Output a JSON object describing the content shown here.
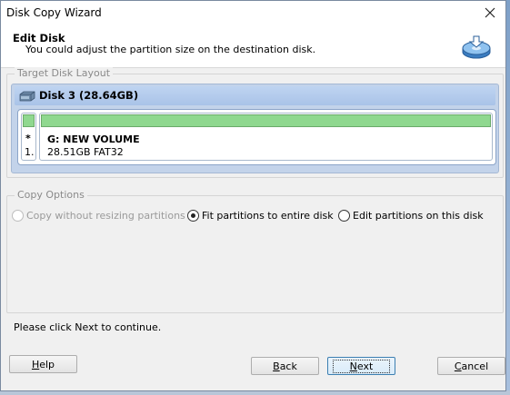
{
  "window": {
    "title": "Disk Copy Wizard"
  },
  "header": {
    "title": "Edit Disk",
    "subtitle": "You could adjust the partition size on the destination disk."
  },
  "target_layout": {
    "legend": "Target Disk Layout",
    "disk_label": "Disk 3 (28.64GB)",
    "mini_partition": {
      "marker": "*",
      "index": "1."
    },
    "partition": {
      "name": "G: NEW VOLUME",
      "info": "28.51GB FAT32"
    }
  },
  "copy_options": {
    "legend": "Copy Options",
    "options": [
      {
        "label": "Copy without resizing partitions",
        "selected": false,
        "enabled": false
      },
      {
        "label": "Fit partitions to entire disk",
        "selected": true,
        "enabled": true
      },
      {
        "label": "Edit partitions on this disk",
        "selected": false,
        "enabled": true
      }
    ]
  },
  "status_text": "Please click Next to continue.",
  "buttons": {
    "help": {
      "mnemonic": "H",
      "rest": "elp"
    },
    "back": {
      "mnemonic": "B",
      "rest": "ack"
    },
    "next": {
      "mnemonic": "N",
      "rest": "ext"
    },
    "cancel": {
      "mnemonic": "C",
      "rest": "ancel"
    }
  },
  "colors": {
    "partition_bar": "#8fd88f",
    "disk_panel": "#c3d3ea",
    "default_button_border": "#3c7fb1"
  }
}
